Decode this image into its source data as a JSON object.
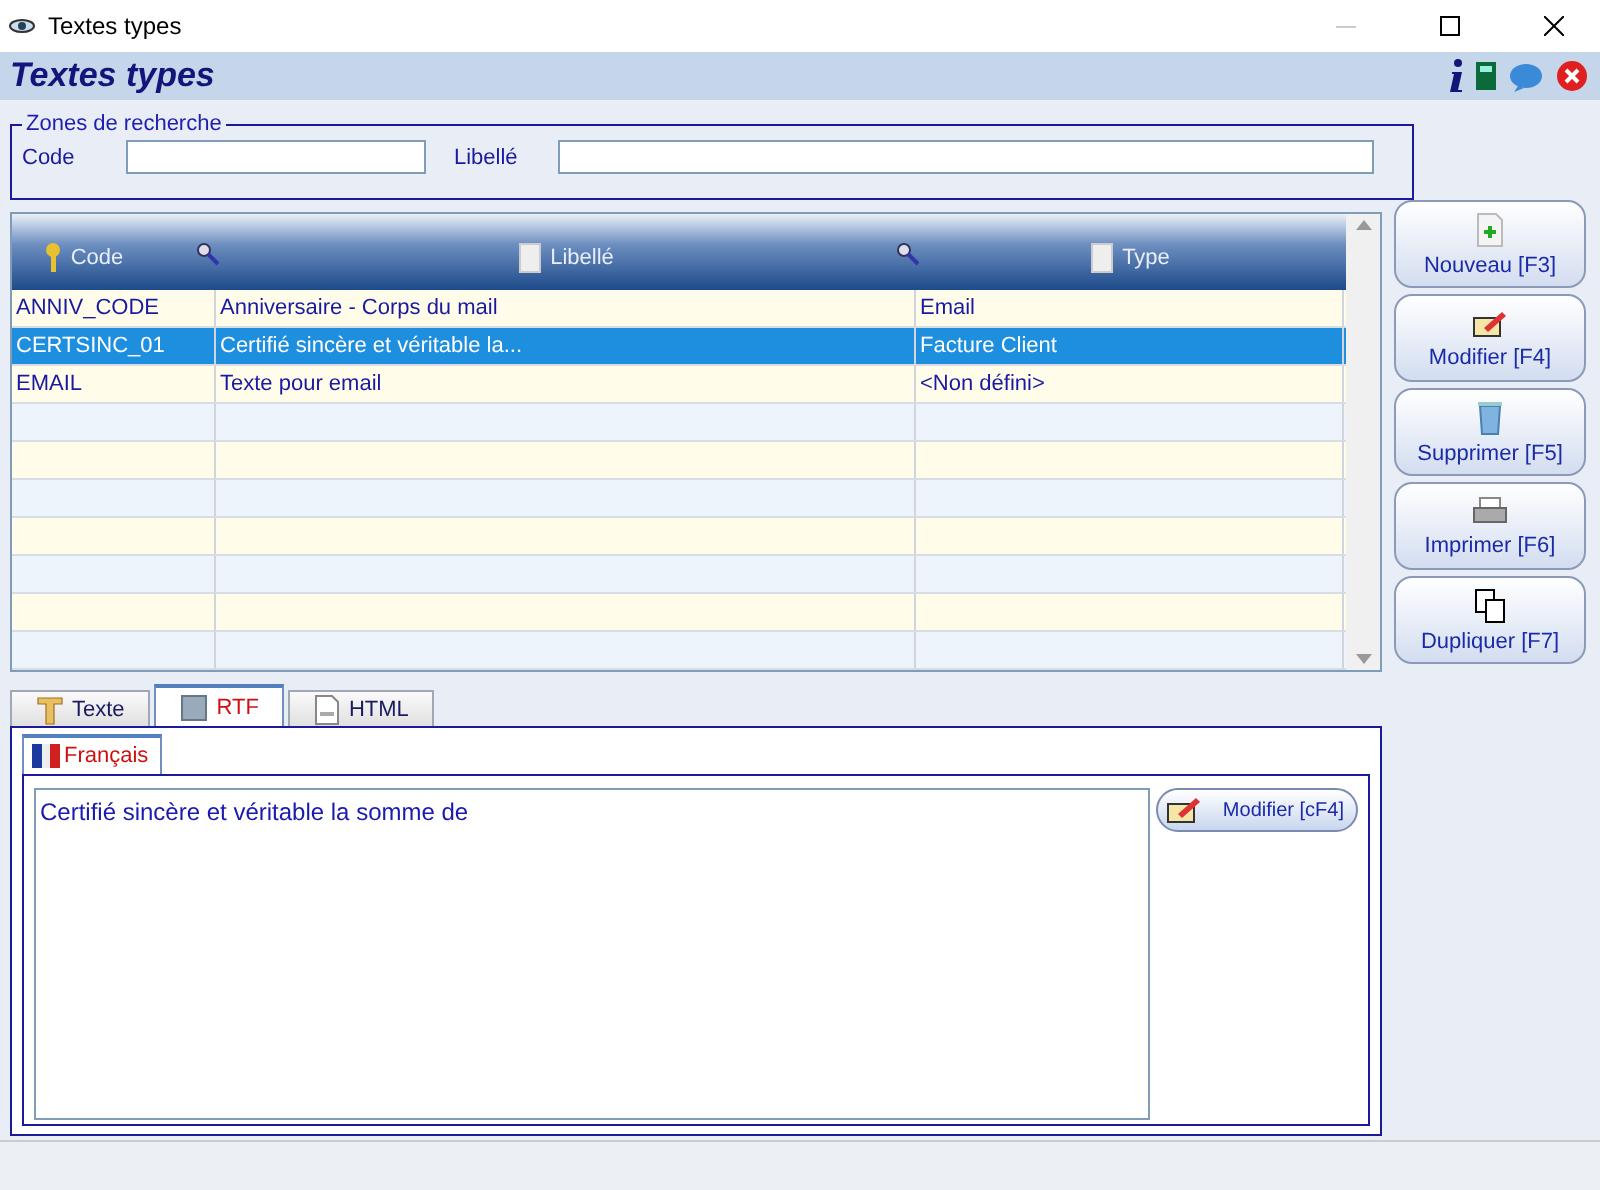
{
  "window": {
    "title": "Textes types"
  },
  "header": {
    "title": "Textes types"
  },
  "search": {
    "legend": "Zones de recherche",
    "fields": [
      {
        "label": "Code"
      },
      {
        "label": "Libellé"
      }
    ]
  },
  "table": {
    "columns": [
      {
        "label": "Code",
        "kind": "key"
      },
      {
        "label": "Libellé",
        "kind": "doc"
      },
      {
        "label": "Type",
        "kind": "doc"
      }
    ],
    "rows": [
      {
        "cells": [
          "ANNIV_CODE",
          "Anniversaire - Corps du mail",
          "Email"
        ],
        "selected": false
      },
      {
        "cells": [
          "CERTSINC_01",
          "Certifié sincère et véritable la...",
          "Facture Client"
        ],
        "selected": true
      },
      {
        "cells": [
          "EMAIL",
          "Texte pour email",
          "<Non défini>"
        ],
        "selected": false
      }
    ]
  },
  "actions": [
    {
      "label": "Nouveau [F3]",
      "kind": "new"
    },
    {
      "label": "Modifier [F4]",
      "kind": "edit"
    },
    {
      "label": "Supprimer [F5]",
      "kind": "delete"
    },
    {
      "label": "Imprimer [F6]",
      "kind": "print"
    },
    {
      "label": "Dupliquer [F7]",
      "kind": "copy"
    }
  ],
  "tabs": [
    {
      "label": "Texte",
      "kind": "text",
      "selected": false
    },
    {
      "label": "RTF",
      "kind": "rtf",
      "selected": true
    },
    {
      "label": "HTML",
      "kind": "html",
      "selected": false
    }
  ],
  "language_tab": {
    "label": "Français"
  },
  "editor": {
    "value": "Certifié sincère et véritable la somme de"
  },
  "edit_button": {
    "label": "Modifier [cF4]"
  }
}
